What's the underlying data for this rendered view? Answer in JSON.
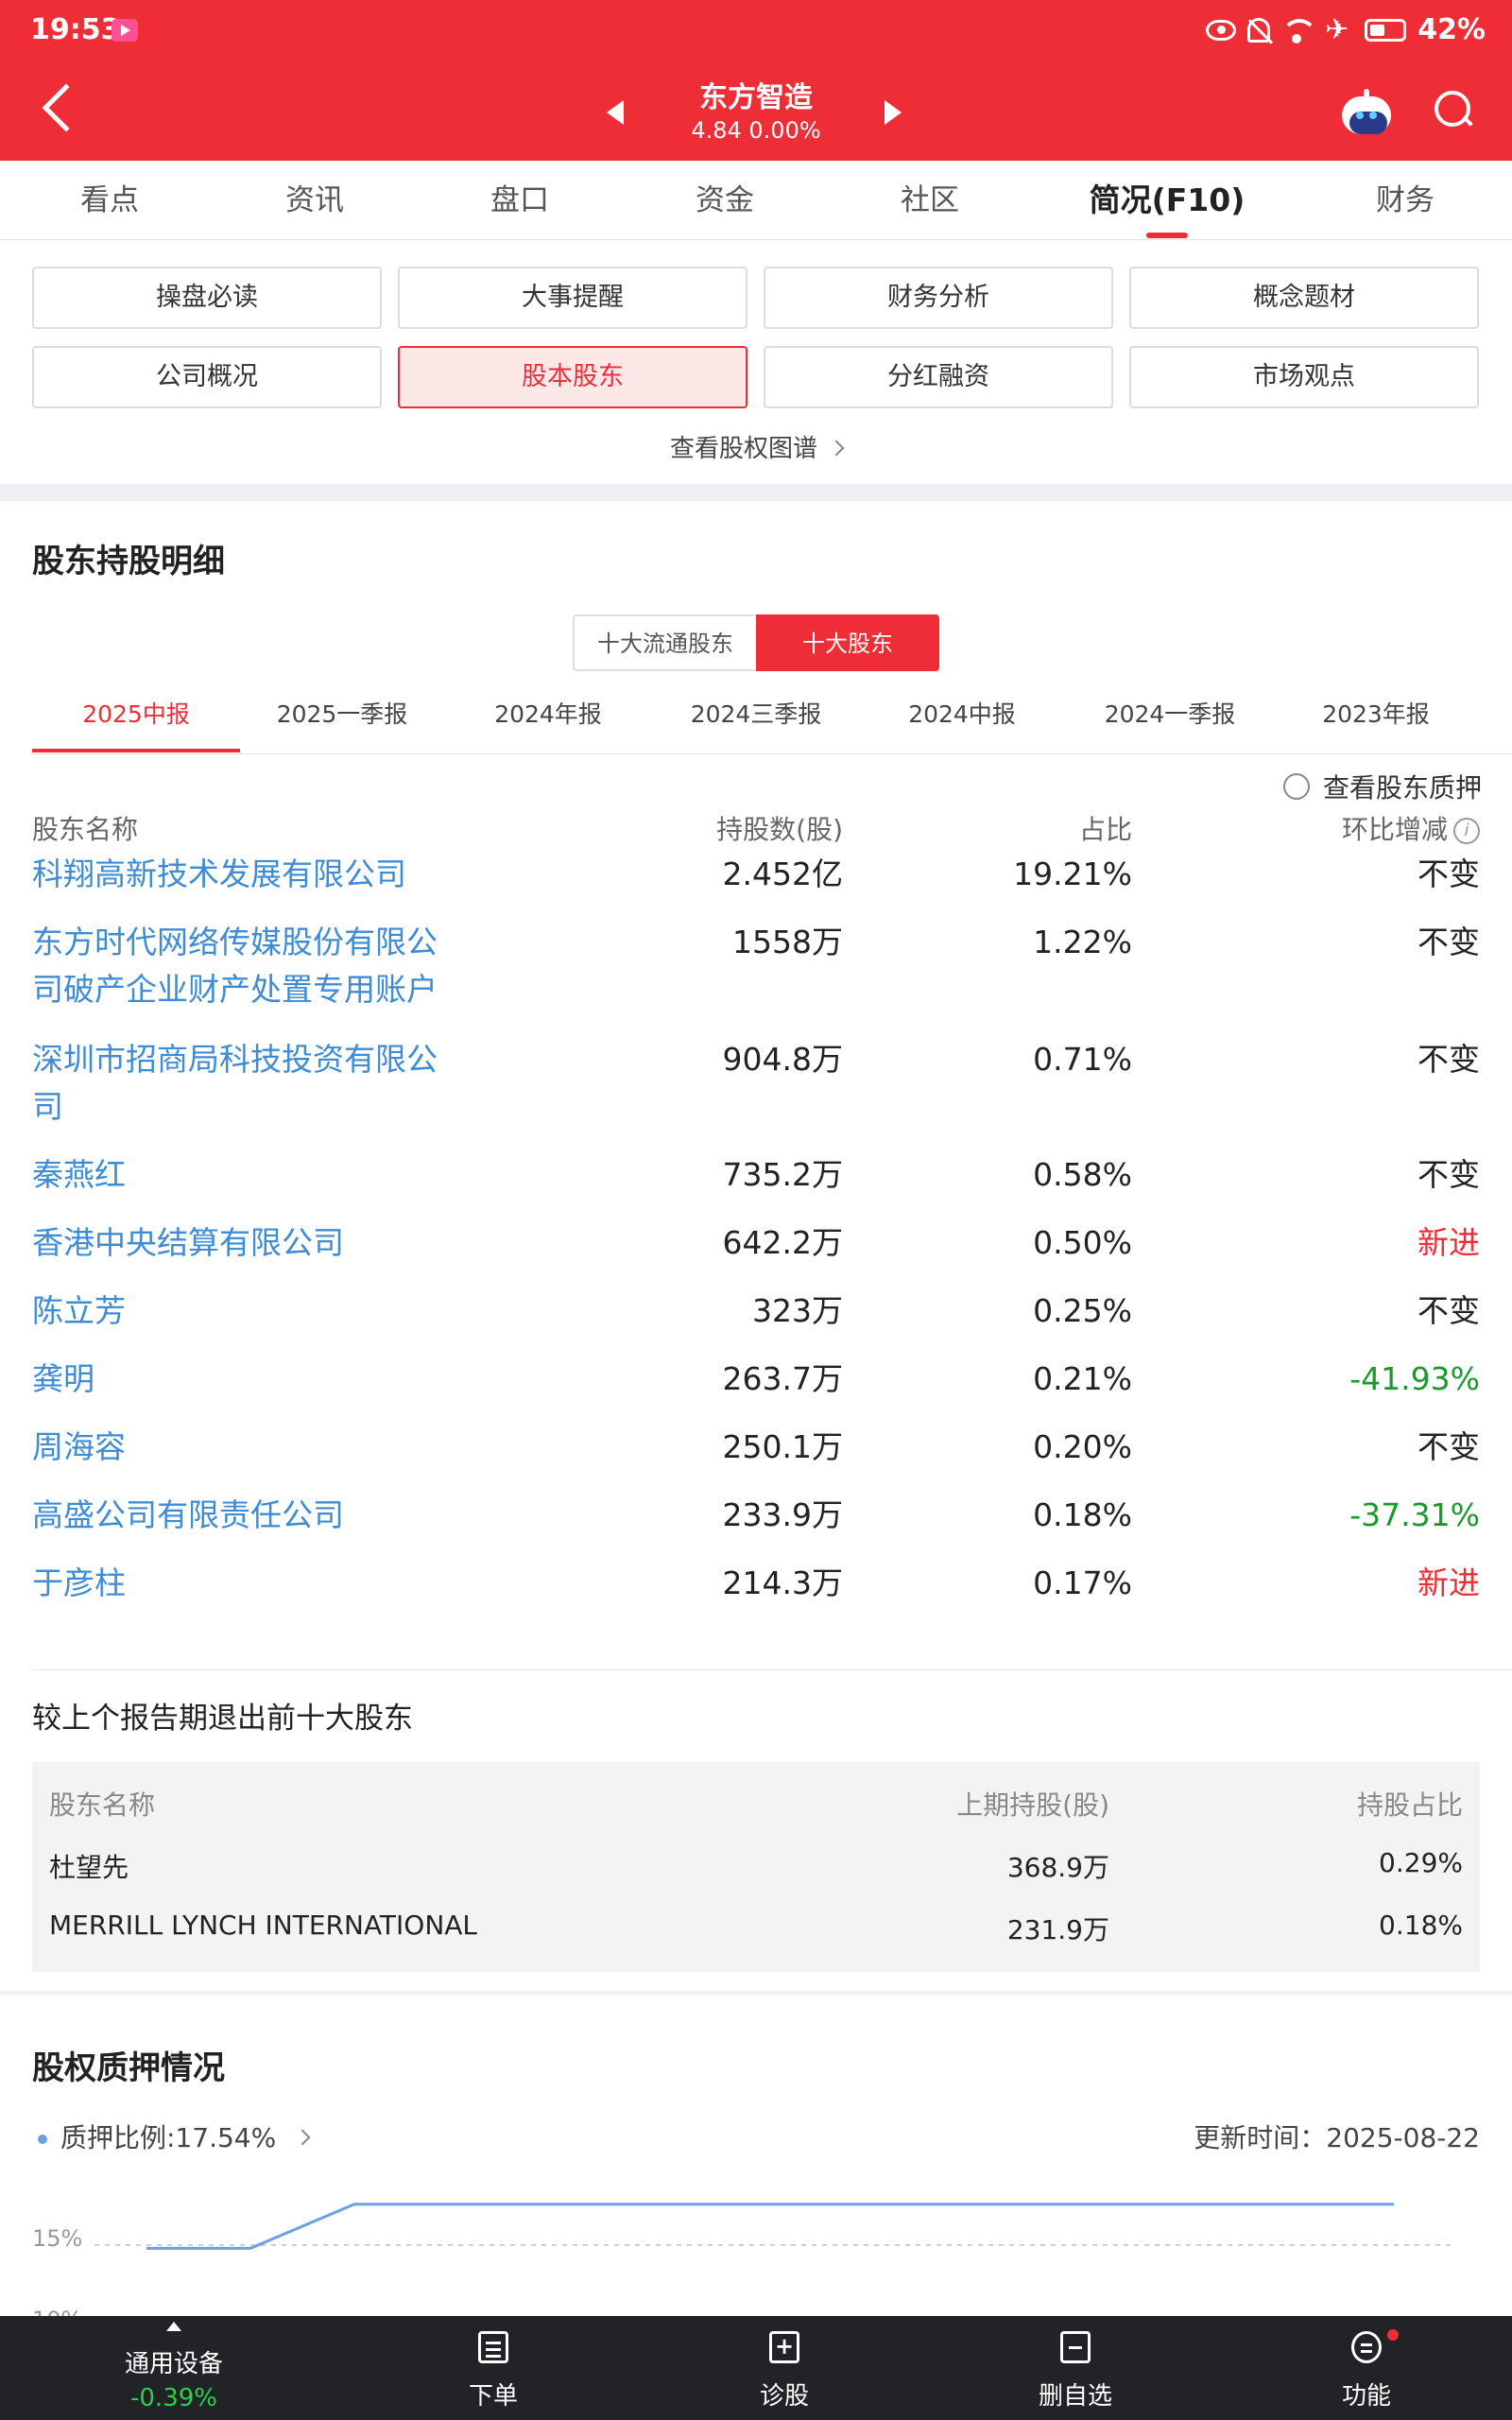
{
  "status_bar": {
    "time": "19:53",
    "battery": "42%",
    "airplane": "✈"
  },
  "header": {
    "stock_name": "东方智造",
    "price_line": "4.84 0.00%"
  },
  "tabs": [
    {
      "label": "看点"
    },
    {
      "label": "资讯"
    },
    {
      "label": "盘口"
    },
    {
      "label": "资金"
    },
    {
      "label": "社区"
    },
    {
      "label": "简况(F10)"
    },
    {
      "label": "财务"
    }
  ],
  "subnav": {
    "buttons": [
      {
        "label": "操盘必读"
      },
      {
        "label": "大事提醒"
      },
      {
        "label": "财务分析"
      },
      {
        "label": "概念题材"
      },
      {
        "label": "公司概况"
      },
      {
        "label": "股本股东"
      },
      {
        "label": "分红融资"
      },
      {
        "label": "市场观点"
      }
    ],
    "equity_link": "查看股权图谱"
  },
  "holdings": {
    "title": "股东持股明细",
    "segment": {
      "left": "十大流通股东",
      "right": "十大股东"
    },
    "periods": [
      "2025中报",
      "2025一季报",
      "2024年报",
      "2024三季报",
      "2024中报",
      "2024一季报",
      "2023年报"
    ],
    "pledge_toggle": "查看股东质押",
    "headers": {
      "name": "股东名称",
      "shares": "持股数(股)",
      "pct": "占比",
      "change": "环比增减"
    },
    "rows": [
      {
        "name": "科翔高新技术发展有限公司",
        "shares": "2.452亿",
        "pct": "19.21%",
        "change": "不变"
      },
      {
        "name": "东方时代网络传媒股份有限公司破产企业财产处置专用账户",
        "shares": "1558万",
        "pct": "1.22%",
        "change": "不变"
      },
      {
        "name": "深圳市招商局科技投资有限公司",
        "shares": "904.8万",
        "pct": "0.71%",
        "change": "不变"
      },
      {
        "name": "秦燕红",
        "shares": "735.2万",
        "pct": "0.58%",
        "change": "不变"
      },
      {
        "name": "香港中央结算有限公司",
        "shares": "642.2万",
        "pct": "0.50%",
        "change": "新进"
      },
      {
        "name": "陈立芳",
        "shares": "323万",
        "pct": "0.25%",
        "change": "不变"
      },
      {
        "name": "龚明",
        "shares": "263.7万",
        "pct": "0.21%",
        "change": "-41.93%"
      },
      {
        "name": "周海容",
        "shares": "250.1万",
        "pct": "0.20%",
        "change": "不变"
      },
      {
        "name": "高盛公司有限责任公司",
        "shares": "233.9万",
        "pct": "0.18%",
        "change": "-37.31%"
      },
      {
        "name": "于彦柱",
        "shares": "214.3万",
        "pct": "0.17%",
        "change": "新进"
      }
    ],
    "exit_title": "较上个报告期退出前十大股东",
    "exit_headers": {
      "name": "股东名称",
      "prev_shares": "上期持股(股)",
      "pct": "持股占比"
    },
    "exit_rows": [
      {
        "name": "杜望先",
        "prev_shares": "368.9万",
        "pct": "0.29%"
      },
      {
        "name": "MERRILL LYNCH INTERNATIONAL",
        "prev_shares": "231.9万",
        "pct": "0.18%"
      }
    ]
  },
  "pledge": {
    "title": "股权质押情况",
    "ratio_label": "质押比例:17.54%",
    "update_time": "更新时间：2025-08-22",
    "axis_label_15": "15%",
    "axis_label_10": "10%"
  },
  "chart_data": {
    "type": "line",
    "series": [
      {
        "values": [
          14.8,
          14.8,
          17.54,
          17.54,
          17.54,
          17.54,
          17.54,
          17.54,
          17.54,
          17.54,
          17.54,
          17.54,
          17.54
        ]
      }
    ],
    "ylim": [
      10,
      20
    ],
    "y_ticks": [
      "15%",
      "10%"
    ],
    "color": "#6aa0e4"
  },
  "bottom_bar": {
    "stock_tab": {
      "name": "通用设备",
      "change": "-0.39%"
    },
    "items": [
      {
        "label": "下单"
      },
      {
        "label": "诊股"
      },
      {
        "label": "删自选"
      },
      {
        "label": "功能"
      }
    ]
  },
  "colors": {
    "brand": "#ee2d37",
    "link": "#3e8bd6",
    "up": "#ee2d37",
    "down": "#1a9a2c"
  }
}
